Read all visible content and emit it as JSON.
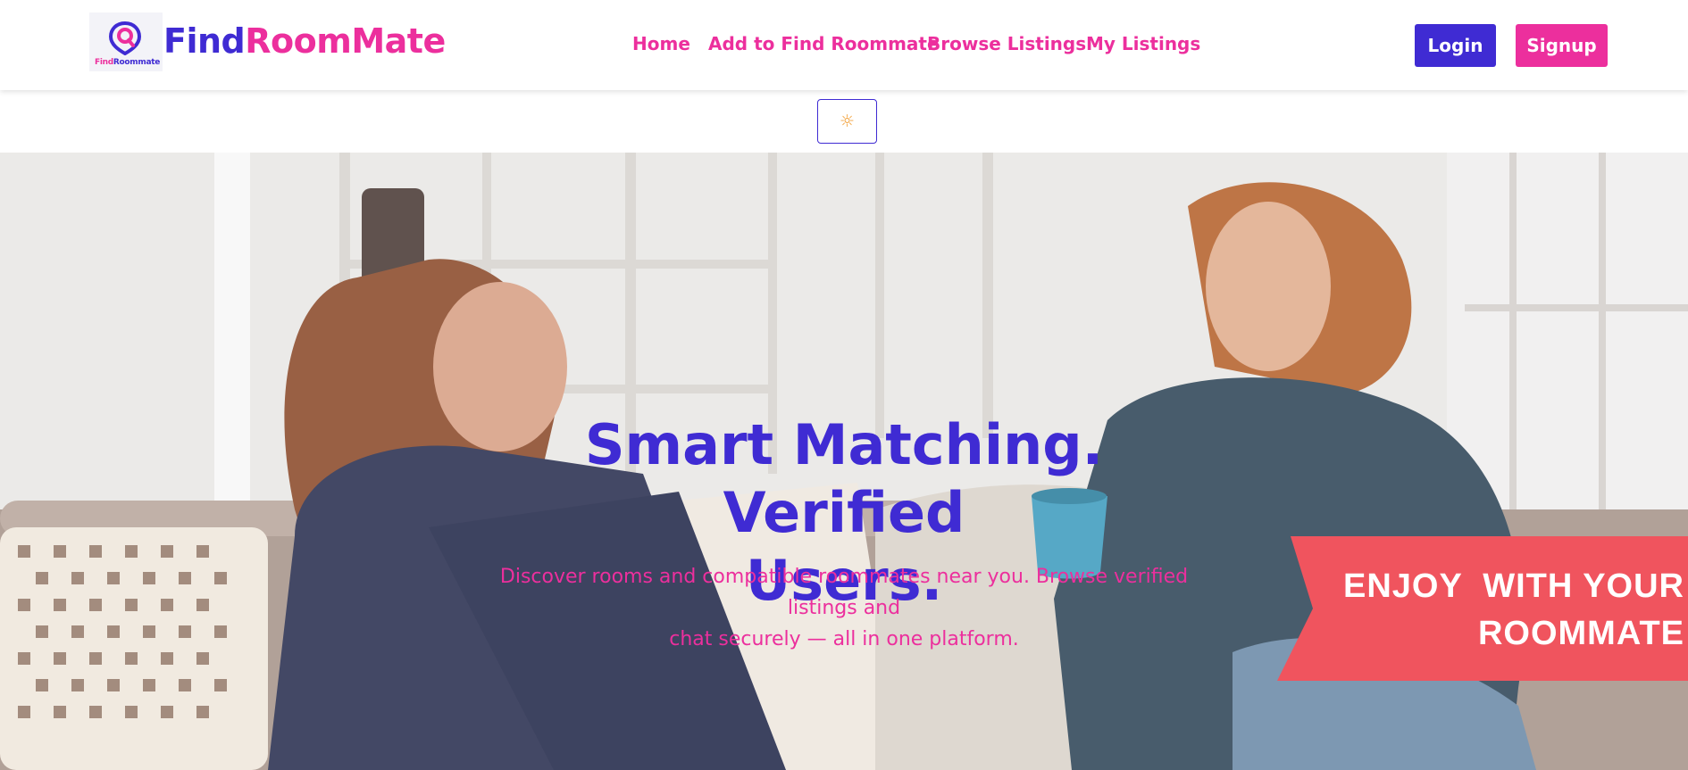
{
  "brand": {
    "logo_caption_part1": "Find",
    "logo_caption_part2": "Roommate",
    "name_part1": "Find",
    "name_part2": "RoomMate"
  },
  "nav": {
    "links": [
      {
        "label": "Home"
      },
      {
        "label": "Add to Find Roommate"
      },
      {
        "label": "Browse Listings"
      },
      {
        "label": "My Listings"
      }
    ],
    "login_label": "Login",
    "signup_label": "Signup"
  },
  "theme_toggle": {
    "icon": "sun-icon",
    "glyph": "☼"
  },
  "hero": {
    "title_line1": "Smart Matching. Verified",
    "title_line2": "Users.",
    "subtitle_line1": "Discover rooms and compatible roommates near you. Browse verified listings and",
    "subtitle_line2": "chat securely — all in one platform.",
    "banner_line1": "ENJOY  WITH YOUR",
    "banner_line2": "ROOMMATE"
  },
  "colors": {
    "primary": "#3f2bd3",
    "accent": "#ec2f9d",
    "banner": "#f0545e",
    "sun": "#f2a23c"
  }
}
